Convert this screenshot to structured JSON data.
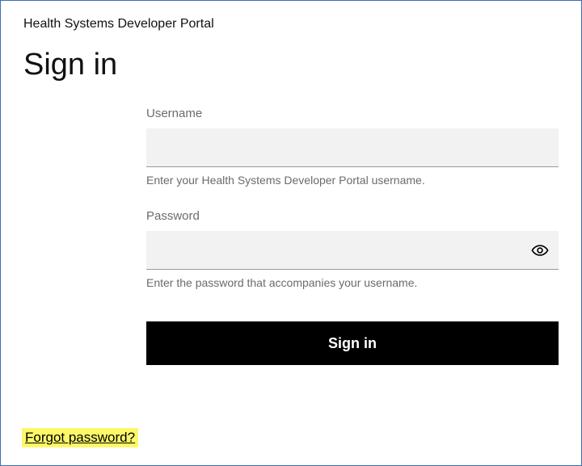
{
  "site_title": "Health Systems Developer Portal",
  "heading": "Sign in",
  "form": {
    "username": {
      "label": "Username",
      "value": "",
      "placeholder": "",
      "help": "Enter your Health Systems Developer Portal username."
    },
    "password": {
      "label": "Password",
      "value": "",
      "placeholder": "",
      "help": "Enter the password that accompanies your username."
    },
    "submit_label": "Sign in"
  },
  "forgot_password_label": "Forgot password?"
}
